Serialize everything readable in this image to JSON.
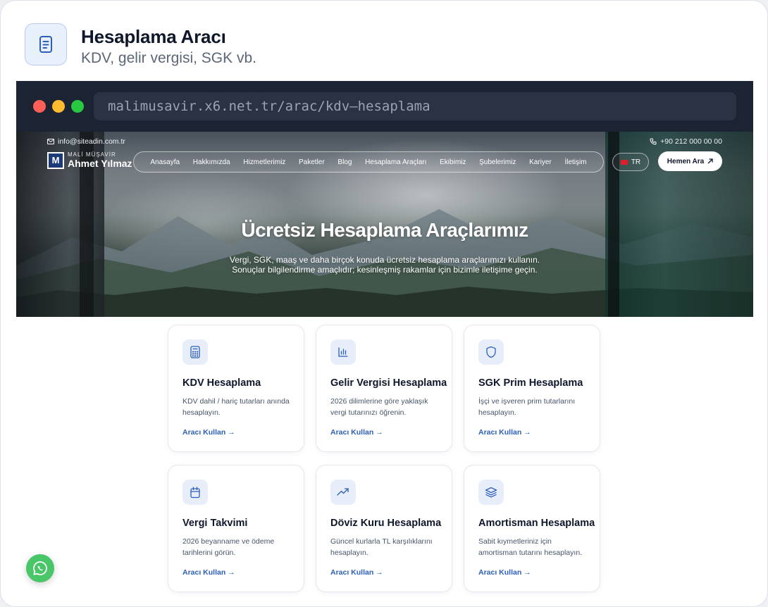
{
  "header": {
    "title": "Hesaplama Aracı",
    "subtitle": "KDV, gelir vergisi, SGK vb.",
    "icon": "document-icon"
  },
  "browser": {
    "url": "malimusavir.x6.net.tr/arac/kdv–hesaplama"
  },
  "site": {
    "email": "info@siteadin.com.tr",
    "phone": "+90 212 000 00 00",
    "logo_small": "MALİ MÜŞAVİR",
    "logo_big": "Ahmet Yılmaz",
    "logo_mark": "M",
    "nav": [
      "Anasayfa",
      "Hakkımızda",
      "Hizmetlerimiz",
      "Paketler",
      "Blog",
      "Hesaplama Araçları",
      "Ekibimiz",
      "Şubelerimiz",
      "Kariyer",
      "İletişim"
    ],
    "lang": "TR",
    "cta": "Hemen Ara"
  },
  "hero": {
    "title": "Ücretsiz Hesaplama Araçlarımız",
    "line1": "Vergi, SGK, maaş ve daha birçok konuda ücretsiz hesaplama araçlarımızı kullanın.",
    "line2": "Sonuçlar bilgilendirme amaçlıdır; kesinleşmiş rakamlar için bizimle iletişime geçin."
  },
  "tools": [
    {
      "title": "KDV Hesaplama",
      "desc": "KDV dahil / hariç tutarları anında hesaplayın.",
      "link": "Aracı Kullan →",
      "icon": "calculator-icon"
    },
    {
      "title": "Gelir Vergisi Hesaplama",
      "desc": "2026 dilimlerine göre yaklaşık vergi tutarınızı öğrenin.",
      "link": "Aracı Kullan →",
      "icon": "bar-chart-icon"
    },
    {
      "title": "SGK Prim Hesaplama",
      "desc": "İşçi ve işveren prim tutarlarını hesaplayın.",
      "link": "Aracı Kullan →",
      "icon": "shield-icon"
    },
    {
      "title": "Vergi Takvimi",
      "desc": "2026 beyanname ve ödeme tarihlerini görün.",
      "link": "Aracı Kullan →",
      "icon": "calendar-icon"
    },
    {
      "title": "Döviz Kuru Hesaplama",
      "desc": "Güncel kurlarla TL karşılıklarını hesaplayın.",
      "link": "Aracı Kullan →",
      "icon": "trending-up-icon"
    },
    {
      "title": "Amortisman Hesaplama",
      "desc": "Sabit kıymetleriniz için amortisman tutarını hesaplayın.",
      "link": "Aracı Kullan →",
      "icon": "layers-icon"
    }
  ],
  "colors": {
    "accent": "#2b5fb9",
    "whatsapp": "#48c668",
    "browser_bar": "#1c2333"
  }
}
